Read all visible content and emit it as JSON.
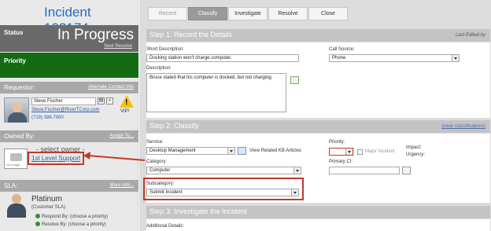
{
  "incident": {
    "title": "Incident 102174"
  },
  "status": {
    "label": "Status",
    "value": "In Progress",
    "next_link": "Next Resolve"
  },
  "priority": {
    "label": "Priority",
    "color": "#136b13"
  },
  "requestor": {
    "header": "Requestor:",
    "alt_link": "Alternate Contact Info",
    "name": "Steve Fischer",
    "email": "Steve.Fischer@RiverTCorp.com",
    "phone": "(719) 386.7000",
    "vip_label": "VIP!"
  },
  "owned_by": {
    "header": "Owned By:",
    "assign_link": "Assign To...",
    "placeholder": "- select owner -",
    "group_link": "1st Level Support",
    "no_image": "No Image"
  },
  "sla": {
    "header": "SLA:",
    "more_link": "More Info...",
    "name": "Platinum",
    "sub": "(Customer SLA)",
    "respond": "Respond By: (choose a priority)",
    "resolve": "Resolve By: (choose a priority)"
  },
  "tabs": [
    {
      "label": "Recent"
    },
    {
      "label": "Classify"
    },
    {
      "label": "Investigate"
    },
    {
      "label": "Resolve"
    },
    {
      "label": "Close"
    }
  ],
  "step1": {
    "title": "Step 1:  Record the Details",
    "last_edited": "Last Edited by",
    "short_desc_label": "Short Description:",
    "short_desc_value": "Docking station won't charge computer.",
    "call_source_label": "Call Source:",
    "call_source_value": "Phone",
    "description_label": "Description:",
    "description_value": "Bruce stated that his computer is docked, but not charging."
  },
  "step2": {
    "title": "Step 2:  Classify",
    "clear_link": "(clear classifications)",
    "service_label": "Service:",
    "service_value": "Desktop Management",
    "kb_link": "View Related KB Articles",
    "category_label": "Category:",
    "category_value": "Computer",
    "subcategory_label": "Subcategory:",
    "subcategory_value": "Submit Incident",
    "priority_label": "Priority:",
    "major_incident": "Major Incident",
    "impact_label": "Impact:",
    "urgency_label": "Urgency:",
    "primary_ci_label": "Primary CI:"
  },
  "step3": {
    "title": "Step 3:  Investigate the Incident",
    "additional_label": "Additional Details:"
  },
  "icons": {
    "highlight_color": "#c0392b",
    "link_color": "#2a5ca8"
  }
}
